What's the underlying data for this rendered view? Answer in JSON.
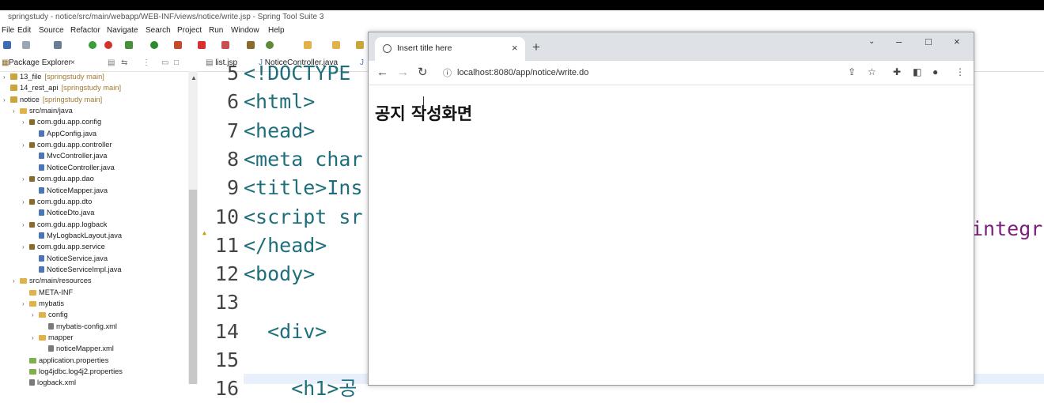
{
  "sts": {
    "window_title": "springstudy - notice/src/main/webapp/WEB-INF/views/notice/write.jsp - Spring Tool Suite 3",
    "menu": [
      "File",
      "Edit",
      "Source",
      "Refactor",
      "Navigate",
      "Search",
      "Project",
      "Run",
      "Window",
      "Help"
    ],
    "explorer": {
      "tab_label": "Package Explorer",
      "tree": [
        {
          "label": "13_file",
          "decor": "[springstudy main]",
          "icon": "project-icon",
          "depth": 0,
          "prefix": "> "
        },
        {
          "label": "14_rest_api",
          "decor": "[springstudy main]",
          "icon": "project-icon",
          "depth": 0,
          "prefix": ""
        },
        {
          "label": "notice",
          "decor": "[springstudy main]",
          "icon": "project-icon",
          "depth": 0,
          "prefix": "> "
        },
        {
          "label": "src/main/java",
          "decor": "",
          "icon": "folder-icon",
          "depth": 1,
          "prefix": "> "
        },
        {
          "label": "com.gdu.app.config",
          "decor": "",
          "icon": "package-icon",
          "depth": 2,
          "prefix": "> "
        },
        {
          "label": "AppConfig.java",
          "decor": "",
          "icon": "java-file-icon",
          "depth": 3,
          "prefix": ""
        },
        {
          "label": "com.gdu.app.controller",
          "decor": "",
          "icon": "package-icon",
          "depth": 2,
          "prefix": "> "
        },
        {
          "label": "MvcController.java",
          "decor": "",
          "icon": "java-file-icon",
          "depth": 3,
          "prefix": ""
        },
        {
          "label": "NoticeController.java",
          "decor": "",
          "icon": "java-file-icon",
          "depth": 3,
          "prefix": ""
        },
        {
          "label": "com.gdu.app.dao",
          "decor": "",
          "icon": "package-icon",
          "depth": 2,
          "prefix": "> "
        },
        {
          "label": "NoticeMapper.java",
          "decor": "",
          "icon": "java-file-icon",
          "depth": 3,
          "prefix": ""
        },
        {
          "label": "com.gdu.app.dto",
          "decor": "",
          "icon": "package-icon",
          "depth": 2,
          "prefix": "> "
        },
        {
          "label": "NoticeDto.java",
          "decor": "",
          "icon": "java-file-icon",
          "depth": 3,
          "prefix": ""
        },
        {
          "label": "com.gdu.app.logback",
          "decor": "",
          "icon": "package-icon",
          "depth": 2,
          "prefix": "> "
        },
        {
          "label": "MyLogbackLayout.java",
          "decor": "",
          "icon": "java-file-icon",
          "depth": 3,
          "prefix": ""
        },
        {
          "label": "com.gdu.app.service",
          "decor": "",
          "icon": "package-icon",
          "depth": 2,
          "prefix": "> "
        },
        {
          "label": "NoticeService.java",
          "decor": "",
          "icon": "java-file-icon",
          "depth": 3,
          "prefix": ""
        },
        {
          "label": "NoticeServiceImpl.java",
          "decor": "",
          "icon": "java-file-icon",
          "depth": 3,
          "prefix": ""
        },
        {
          "label": "src/main/resources",
          "decor": "",
          "icon": "folder-icon",
          "depth": 1,
          "prefix": "> "
        },
        {
          "label": "META-INF",
          "decor": "",
          "icon": "folder-icon",
          "depth": 2,
          "prefix": ""
        },
        {
          "label": "mybatis",
          "decor": "",
          "icon": "folder-icon",
          "depth": 2,
          "prefix": "> "
        },
        {
          "label": "config",
          "decor": "",
          "icon": "folder-icon",
          "depth": 3,
          "prefix": "> "
        },
        {
          "label": "mybatis-config.xml",
          "decor": "",
          "icon": "xml-file-icon",
          "depth": 4,
          "prefix": ""
        },
        {
          "label": "mapper",
          "decor": "",
          "icon": "folder-icon",
          "depth": 3,
          "prefix": "> "
        },
        {
          "label": "noticeMapper.xml",
          "decor": "",
          "icon": "xml-file-icon",
          "depth": 4,
          "prefix": ""
        },
        {
          "label": "application.properties",
          "decor": "",
          "icon": "properties-file-icon",
          "depth": 2,
          "prefix": ""
        },
        {
          "label": "log4jdbc.log4j2.properties",
          "decor": "",
          "icon": "properties-file-icon",
          "depth": 2,
          "prefix": ""
        },
        {
          "label": "logback.xml",
          "decor": "",
          "icon": "xml-file-icon",
          "depth": 2,
          "prefix": ""
        }
      ]
    },
    "editor_tabs": [
      "list.jsp",
      "NoticeController.java"
    ],
    "code_lines": [
      {
        "n": "5",
        "code": "<!DOCTYPE"
      },
      {
        "n": "6",
        "code": "<html>"
      },
      {
        "n": "7",
        "code": "<head>"
      },
      {
        "n": "8",
        "code": "<meta char"
      },
      {
        "n": "9",
        "code": "<title>Ins"
      },
      {
        "n": "10",
        "code": "<script sr"
      },
      {
        "n": "11",
        "code": "</head>"
      },
      {
        "n": "12",
        "code": "<body>"
      },
      {
        "n": "13",
        "code": ""
      },
      {
        "n": "14",
        "code": "  <div>"
      },
      {
        "n": "15",
        "code": ""
      },
      {
        "n": "16",
        "code": "    <h1>공"
      }
    ],
    "right_code_fragment": "integr"
  },
  "browser": {
    "tab_title": "Insert title here",
    "url": "localhost:8080/app/notice/write.do",
    "page_heading": "공지 작성화면"
  }
}
